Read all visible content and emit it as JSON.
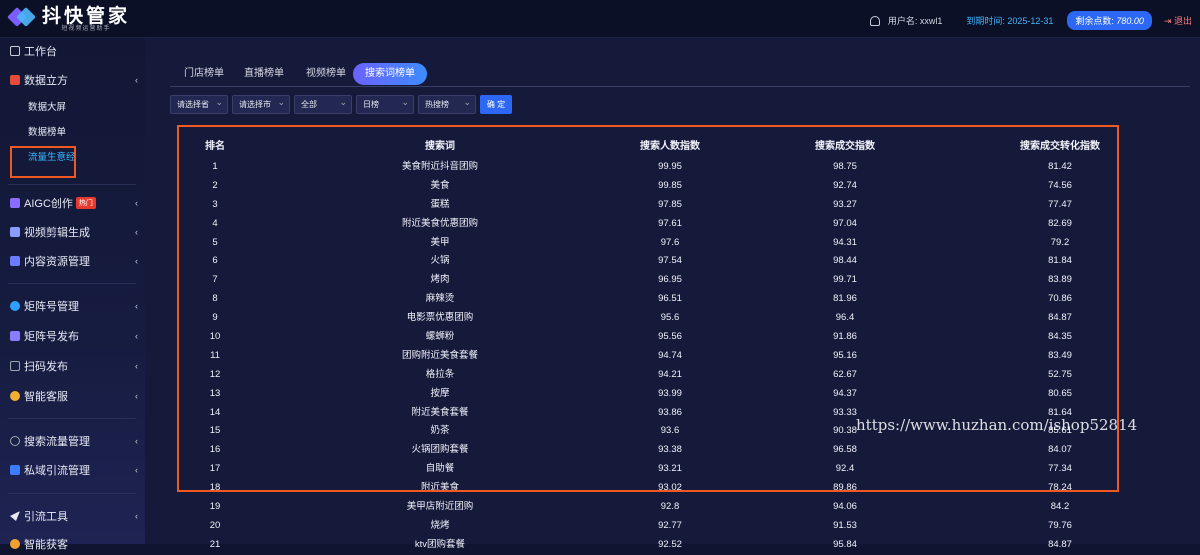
{
  "app": {
    "logo_title": "抖快管家",
    "logo_sub": "短视频运营助手"
  },
  "header": {
    "user_label": "用户名: xxwl1",
    "expire_label": "到期时间: 2025-12-31",
    "points_label": "剩余点数:",
    "points_value": "780.00",
    "logout_label": "退出"
  },
  "sidebar": {
    "workbench": "工作台",
    "data_cube": "数据立方",
    "sub_items": [
      "数据大屏",
      "数据榜单",
      "流量生意经"
    ],
    "aigc": "AIGC创作",
    "hot_badge": "热门",
    "video_edit": "视频剪辑生成",
    "content_mgmt": "内容资源管理",
    "matrix_mgmt": "矩阵号管理",
    "matrix_publish": "矩阵号发布",
    "scan_publish": "扫码发布",
    "smart_service": "智能客服",
    "search_traffic": "搜索流量管理",
    "private_traffic": "私域引流管理",
    "traffic_tools": "引流工具",
    "cut_item": "智能获客"
  },
  "tabs": [
    "门店榜单",
    "直播榜单",
    "视频榜单",
    "搜索词榜单"
  ],
  "filters": {
    "province": "请选择省",
    "city": "请选择市",
    "category": "全部",
    "period": "日榜",
    "type": "热搜榜",
    "confirm": "确 定"
  },
  "table": {
    "headers": [
      "排名",
      "搜索词",
      "搜索人数指数",
      "搜索成交指数",
      "搜索成交转化指数"
    ],
    "rows": [
      [
        "1",
        "美食附近抖音团购",
        "99.95",
        "98.75",
        "81.42"
      ],
      [
        "2",
        "美食",
        "99.85",
        "92.74",
        "74.56"
      ],
      [
        "3",
        "蛋糕",
        "97.85",
        "93.27",
        "77.47"
      ],
      [
        "4",
        "附近美食优惠团购",
        "97.61",
        "97.04",
        "82.69"
      ],
      [
        "5",
        "美甲",
        "97.6",
        "94.31",
        "79.2"
      ],
      [
        "6",
        "火锅",
        "97.54",
        "98.44",
        "81.84"
      ],
      [
        "7",
        "烤肉",
        "96.95",
        "99.71",
        "83.89"
      ],
      [
        "8",
        "麻辣烫",
        "96.51",
        "81.96",
        "70.86"
      ],
      [
        "9",
        "电影票优惠团购",
        "95.6",
        "96.4",
        "84.87"
      ],
      [
        "10",
        "螺蛳粉",
        "95.56",
        "91.86",
        "84.35"
      ],
      [
        "11",
        "团购附近美食套餐",
        "94.74",
        "95.16",
        "83.49"
      ],
      [
        "12",
        "格拉条",
        "94.21",
        "62.67",
        "52.75"
      ],
      [
        "13",
        "按摩",
        "93.99",
        "94.37",
        "80.65"
      ],
      [
        "14",
        "附近美食套餐",
        "93.86",
        "93.33",
        "81.64"
      ],
      [
        "15",
        "奶茶",
        "93.6",
        "90.38",
        "85.61"
      ],
      [
        "16",
        "火锅团购套餐",
        "93.38",
        "96.58",
        "84.07"
      ],
      [
        "17",
        "自助餐",
        "93.21",
        "92.4",
        "77.34"
      ],
      [
        "18",
        "附近美食",
        "93.02",
        "89.86",
        "78.24"
      ],
      [
        "19",
        "美甲店附近团购",
        "92.8",
        "94.06",
        "84.2"
      ],
      [
        "20",
        "烧烤",
        "92.77",
        "91.53",
        "79.76"
      ],
      [
        "21",
        "ktv团购套餐",
        "92.52",
        "95.84",
        "84.87"
      ]
    ]
  },
  "watermark": "https://www.huzhan.com/ishop52814"
}
